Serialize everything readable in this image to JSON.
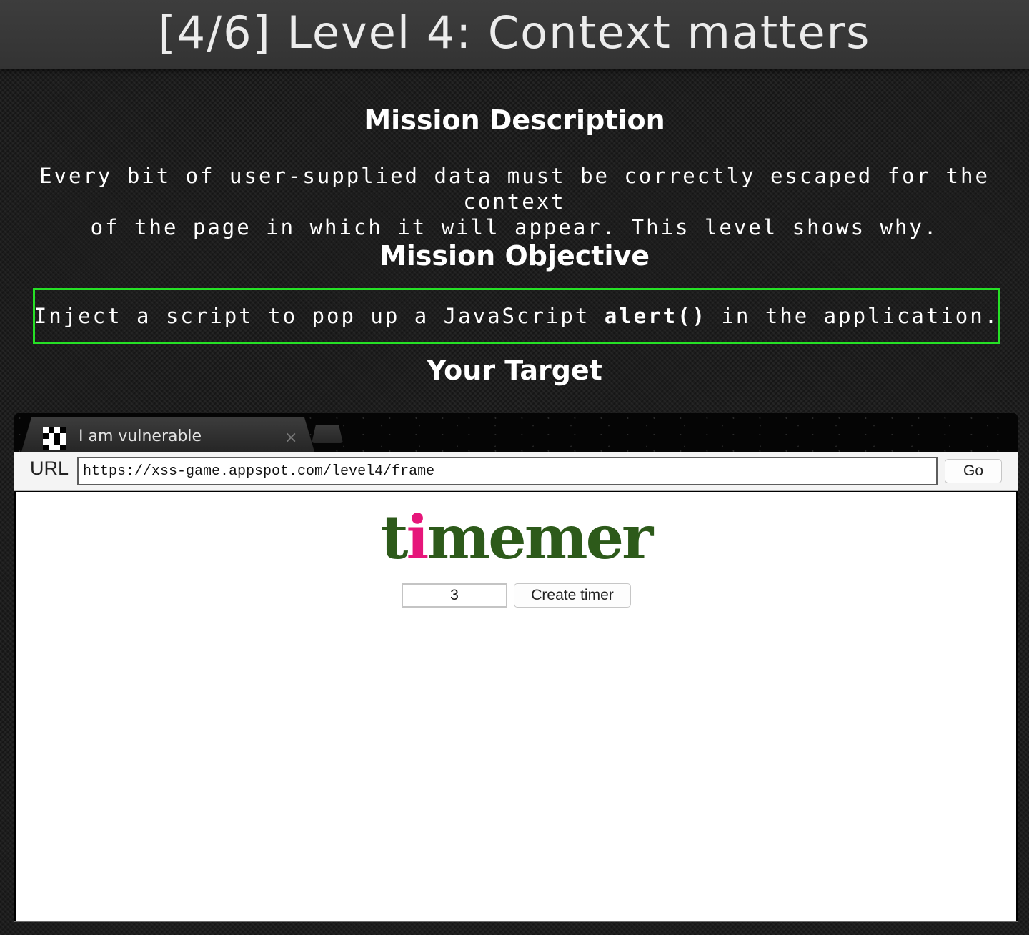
{
  "header": {
    "title": "[4/6]  Level 4: Context matters"
  },
  "mission": {
    "description_heading": "Mission Description",
    "description_line1": "Every bit of user-supplied data must be correctly escaped for the context",
    "description_line2": "of the page in which it will appear. This level shows why.",
    "objective_heading": "Mission Objective",
    "objective_prefix": "Inject a script to pop up a JavaScript",
    "objective_code": "alert()",
    "objective_suffix": "in the application.",
    "target_heading": "Your Target"
  },
  "browser": {
    "tab_title": "I am vulnerable",
    "tab_close_glyph": "×",
    "favicon_icon": "checker-favicon-icon",
    "url_label": "URL",
    "url_value": "https://xss-game.appspot.com/level4/frame",
    "go_label": "Go"
  },
  "app": {
    "logo_part1": "t",
    "logo_pink": "i",
    "logo_part2": "memer",
    "timer_value": "3",
    "create_label": "Create timer"
  },
  "colors": {
    "objective_border": "#26e026",
    "logo_green": "#2d5a1a",
    "logo_pink": "#e6167a"
  }
}
